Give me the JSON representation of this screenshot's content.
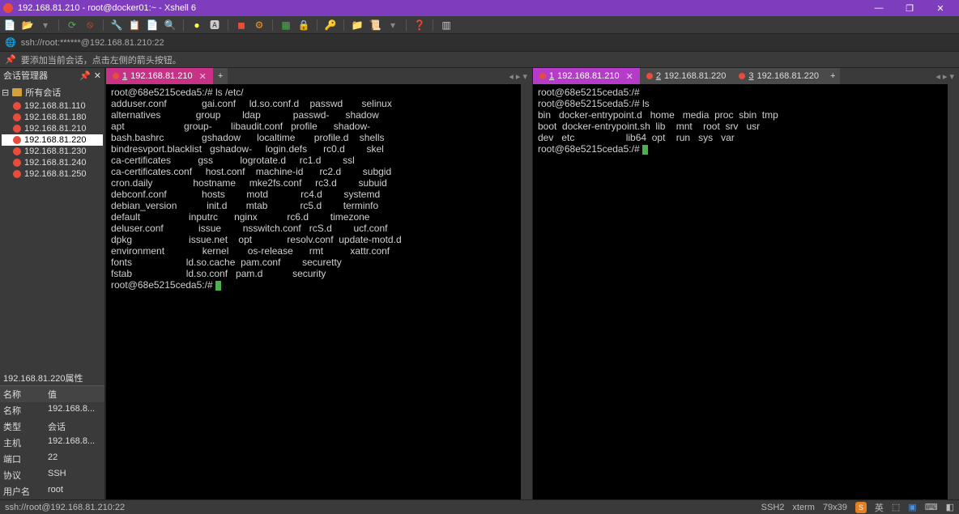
{
  "title": "192.168.81.210 - root@docker01:~ - Xshell 6",
  "address": "ssh://root:******@192.168.81.210:22",
  "hint": "要添加当前会话，点击左侧的箭头按钮。",
  "sidebar": {
    "title": "会话管理器",
    "root": "所有会话",
    "items": [
      {
        "label": "192.168.81.110"
      },
      {
        "label": "192.168.81.180"
      },
      {
        "label": "192.168.81.210"
      },
      {
        "label": "192.168.81.220",
        "selected": true
      },
      {
        "label": "192.168.81.230"
      },
      {
        "label": "192.168.81.240"
      },
      {
        "label": "192.168.81.250"
      }
    ]
  },
  "prop": {
    "title": "192.168.81.220属性",
    "hname": "名称",
    "hval": "值",
    "rows": [
      {
        "k": "名称",
        "v": "192.168.8..."
      },
      {
        "k": "类型",
        "v": "会话"
      },
      {
        "k": "主机",
        "v": "192.168.8..."
      },
      {
        "k": "端口",
        "v": "22"
      },
      {
        "k": "协议",
        "v": "SSH"
      },
      {
        "k": "用户名",
        "v": "root"
      }
    ]
  },
  "left": {
    "tabs": [
      {
        "n": "1",
        "label": "192.168.81.210",
        "active": true
      }
    ],
    "out": "root@68e5215ceda5:/# ls /etc/\nadduser.conf             gai.conf     ld.so.conf.d    passwd       selinux\nalternatives             group        ldap            passwd-      shadow\napt                      group-       libaudit.conf   profile      shadow-\nbash.bashrc              gshadow      localtime       profile.d    shells\nbindresvport.blacklist   gshadow-     login.defs      rc0.d        skel\nca-certificates          gss          logrotate.d     rc1.d        ssl\nca-certificates.conf     host.conf    machine-id      rc2.d        subgid\ncron.daily               hostname     mke2fs.conf     rc3.d        subuid\ndebconf.conf             hosts        motd            rc4.d        systemd\ndebian_version           init.d       mtab            rc5.d        terminfo\ndefault                  inputrc      nginx           rc6.d        timezone\ndeluser.conf             issue        nsswitch.conf   rcS.d        ucf.conf\ndpkg                     issue.net    opt             resolv.conf  update-motd.d\nenvironment              kernel       os-release      rmt          xattr.conf\nfonts                    ld.so.cache  pam.conf        securetty\nfstab                    ld.so.conf   pam.d           security\nroot@68e5215ceda5:/# "
  },
  "right": {
    "tabs": [
      {
        "n": "1",
        "label": "192.168.81.210",
        "active": true
      },
      {
        "n": "2",
        "label": "192.168.81.220"
      },
      {
        "n": "3",
        "label": "192.168.81.220"
      }
    ],
    "out": "root@68e5215ceda5:/#\nroot@68e5215ceda5:/# ls\nbin   docker-entrypoint.d   home   media  proc  sbin  tmp\nboot  docker-entrypoint.sh  lib    mnt    root  srv   usr\ndev   etc                   lib64  opt    run   sys   var\nroot@68e5215ceda5:/# "
  },
  "status": {
    "left": "ssh://root@192.168.81.210:22",
    "ssh": "SSH2",
    "term": "xterm",
    "size": "79x39"
  },
  "win": {
    "min": "—",
    "max": "❐",
    "close": "✕"
  }
}
